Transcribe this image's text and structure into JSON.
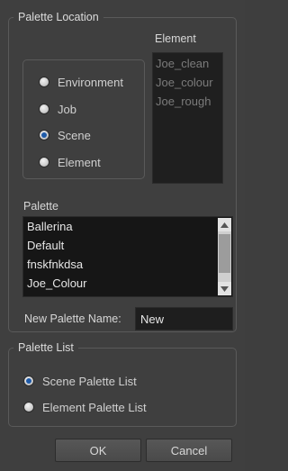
{
  "palette_location": {
    "title": "Palette Location",
    "radios": [
      {
        "label": "Environment",
        "checked": false
      },
      {
        "label": "Job",
        "checked": false
      },
      {
        "label": "Scene",
        "checked": true
      },
      {
        "label": "Element",
        "checked": false
      }
    ],
    "element_label": "Element",
    "element_items": [
      "Joe_clean",
      "Joe_colour",
      "Joe_rough"
    ],
    "palette_label": "Palette",
    "palette_items": [
      "Ballerina",
      "Default",
      "fnskfnkdsa",
      "Joe_Colour"
    ],
    "new_palette_label": "New Palette Name:",
    "new_palette_value": "New"
  },
  "palette_list": {
    "title": "Palette List",
    "radios": [
      {
        "label": "Scene Palette List",
        "checked": true
      },
      {
        "label": "Element Palette List",
        "checked": false
      }
    ]
  },
  "buttons": {
    "ok": "OK",
    "cancel": "Cancel"
  },
  "colors": {
    "background": "#3f3f3f",
    "list_background": "#1f1f1f",
    "radio_selected": "#1e5aa8"
  }
}
